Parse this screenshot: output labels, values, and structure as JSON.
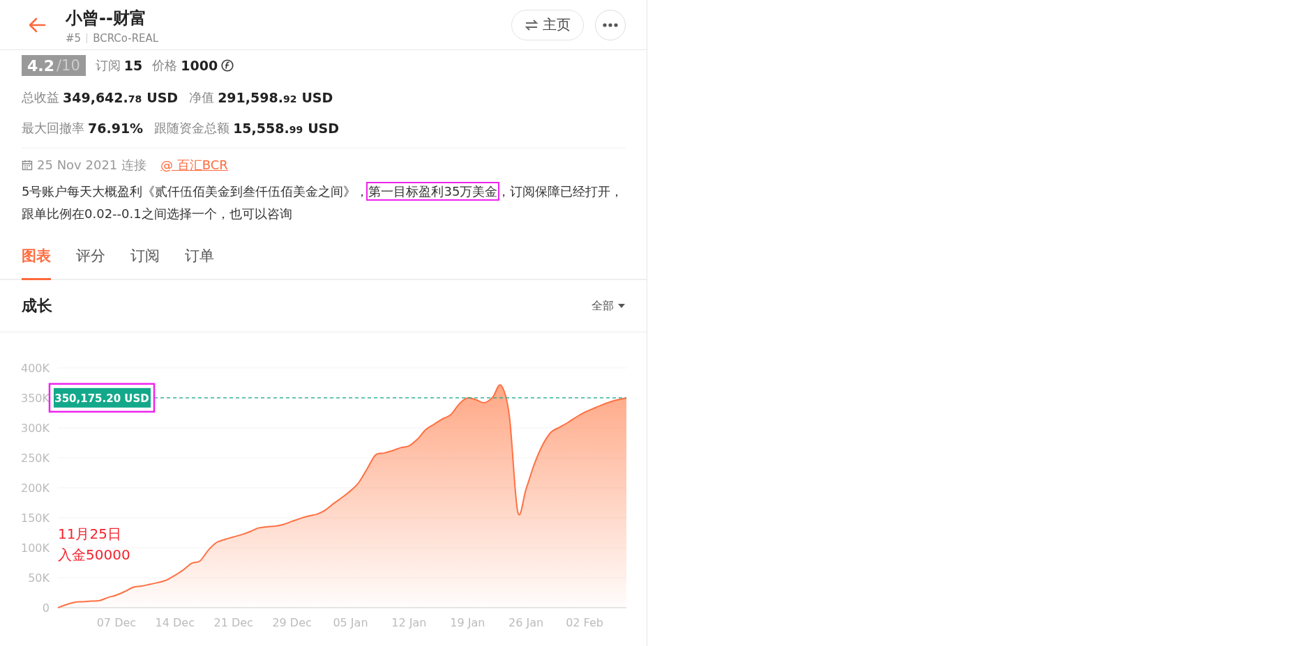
{
  "header": {
    "title": "小曾--财富",
    "rank": "#5",
    "account": "BCRCo-REAL",
    "home_button": "主页"
  },
  "rating": {
    "score": "4.2",
    "max": "/10"
  },
  "summary": [
    {
      "label": "订阅",
      "value": "15",
      "kind": "plain"
    },
    {
      "label": "价格",
      "value": "1000",
      "kind": "coin"
    }
  ],
  "metrics": [
    [
      {
        "label": "总收益",
        "value": "349,642.",
        "decimals": "78",
        "unit": "USD"
      },
      {
        "label": "净值",
        "value": "291,598.",
        "decimals": "92",
        "unit": "USD"
      }
    ],
    [
      {
        "label": "最大回撤率",
        "value": "76.91%"
      },
      {
        "label": "跟随资金总额",
        "value": "15,558.",
        "decimals": "99",
        "unit": "USD"
      }
    ]
  ],
  "connection": {
    "date": "25 Nov 2021",
    "label": "连接",
    "link": "@ 百汇BCR"
  },
  "description": [
    {
      "text": "5号账户每天大概盈利《贰仟伍佰美金到叁仟伍佰美金之间》，",
      "highlighted": false
    },
    {
      "text": "第一目标盈利35万美金",
      "highlighted": true
    },
    {
      "text": "，订阅保障已经打开，跟单比例在0.02--0.1之间选择一个，也可以咨询",
      "highlighted": false
    }
  ],
  "tabs": [
    {
      "label": "图表",
      "selected": true
    },
    {
      "label": "评分",
      "selected": false
    },
    {
      "label": "订阅",
      "selected": false
    },
    {
      "label": "订单",
      "selected": false
    }
  ],
  "section": {
    "title": "成长",
    "filter": "全部"
  },
  "chart_overlay": {
    "badge_highlighted": true,
    "note": [
      "11月25日",
      "入金50000"
    ]
  },
  "chart_data": {
    "type": "area",
    "grid": true,
    "ylim": [
      0,
      400000
    ],
    "yticks": [
      {
        "value": 0,
        "label": "0"
      },
      {
        "value": 50000,
        "label": "50K"
      },
      {
        "value": 100000,
        "label": "100K"
      },
      {
        "value": 150000,
        "label": "150K"
      },
      {
        "value": 200000,
        "label": "200K"
      },
      {
        "value": 250000,
        "label": "250K"
      },
      {
        "value": 300000,
        "label": "300K"
      },
      {
        "value": 350000,
        "label": "350K"
      },
      {
        "value": 400000,
        "label": "400K"
      }
    ],
    "categories": [
      null,
      null,
      null,
      null,
      null,
      null,
      null,
      "07 Dec",
      null,
      null,
      null,
      null,
      null,
      null,
      "14 Dec",
      null,
      null,
      null,
      null,
      null,
      null,
      "21 Dec",
      null,
      null,
      null,
      null,
      null,
      null,
      "29 Dec",
      null,
      null,
      null,
      null,
      null,
      null,
      "05 Jan",
      null,
      null,
      null,
      null,
      null,
      null,
      "12 Jan",
      null,
      null,
      null,
      null,
      null,
      null,
      "19 Jan",
      null,
      null,
      null,
      null,
      null,
      null,
      "26 Jan",
      null,
      null,
      null,
      null,
      null,
      null,
      "02 Feb",
      null,
      null,
      null,
      null,
      null
    ],
    "series": [
      {
        "color": "#ff7043",
        "values": [
          0,
          5000,
          9000,
          10000,
          11000,
          12000,
          17000,
          21000,
          27000,
          34000,
          36000,
          39000,
          42000,
          46000,
          54000,
          63000,
          74000,
          78000,
          96000,
          109000,
          114000,
          118000,
          122000,
          127000,
          133000,
          135000,
          136000,
          139000,
          144000,
          149000,
          153000,
          156000,
          163000,
          174000,
          184000,
          195000,
          209000,
          232000,
          255000,
          258000,
          262000,
          267000,
          270000,
          281000,
          297000,
          306000,
          315000,
          322000,
          340000,
          350000,
          347000,
          342000,
          351000,
          371000,
          320000,
          160000,
          198000,
          240000,
          272000,
          293000,
          301000,
          309000,
          318000,
          326000,
          332000,
          338000,
          343000,
          347000,
          350000
        ]
      }
    ],
    "ref_lines": [
      {
        "axis": "y",
        "value": 350175.2,
        "label": "350,175.20 USD"
      }
    ]
  }
}
